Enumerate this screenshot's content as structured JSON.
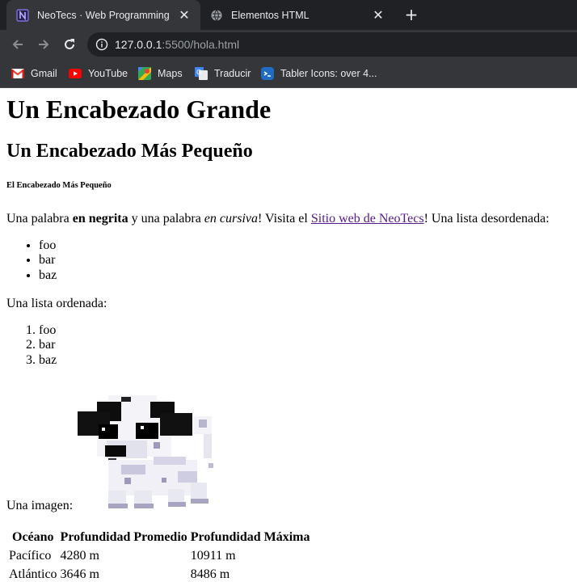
{
  "browser": {
    "tabs": [
      {
        "title": "NeoTecs · Web Programming",
        "icon": "neotecs-favicon",
        "active": true
      },
      {
        "title": "Elementos HTML",
        "icon": "globe-icon",
        "active": false
      }
    ],
    "url_host": "127.0.0.1",
    "url_rest": ":5500/hola.html",
    "bookmarks": [
      {
        "label": "Gmail",
        "icon": "gmail-icon"
      },
      {
        "label": "YouTube",
        "icon": "youtube-icon"
      },
      {
        "label": "Maps",
        "icon": "maps-icon"
      },
      {
        "label": "Traducir",
        "icon": "translate-icon"
      },
      {
        "label": "Tabler Icons: over 4...",
        "icon": "tabler-icon"
      }
    ],
    "colors": {
      "tabstrip": "#202124",
      "toolbar": "#35363a",
      "text": "#e8eaed",
      "link": "#551a8b"
    }
  },
  "page": {
    "h1": "Un Encabezado Grande",
    "h2": "Un Encabezado Más Pequeño",
    "h5": "El Encabezado Más Pequeño",
    "para1": {
      "t1": "Una palabra ",
      "bold": "en negrita",
      "t2": " y una palabra ",
      "italic": "en cursiva",
      "t3": "! Visita el ",
      "link": "Sitio web de NeoTecs",
      "t4": "! Una lista desordenada:"
    },
    "unordered": [
      "foo",
      "bar",
      "baz"
    ],
    "para2": "Una lista ordenada:",
    "ordered": [
      "foo",
      "bar",
      "baz"
    ],
    "image_label": "Una imagen:",
    "table": {
      "headers": [
        "Océano",
        "Profundidad Promedio",
        "Profundidad Máxima"
      ],
      "rows": [
        [
          "Pacífico",
          "4280 m",
          "10911 m"
        ],
        [
          "Atlántico",
          "3646 m",
          "8486 m"
        ]
      ]
    }
  }
}
